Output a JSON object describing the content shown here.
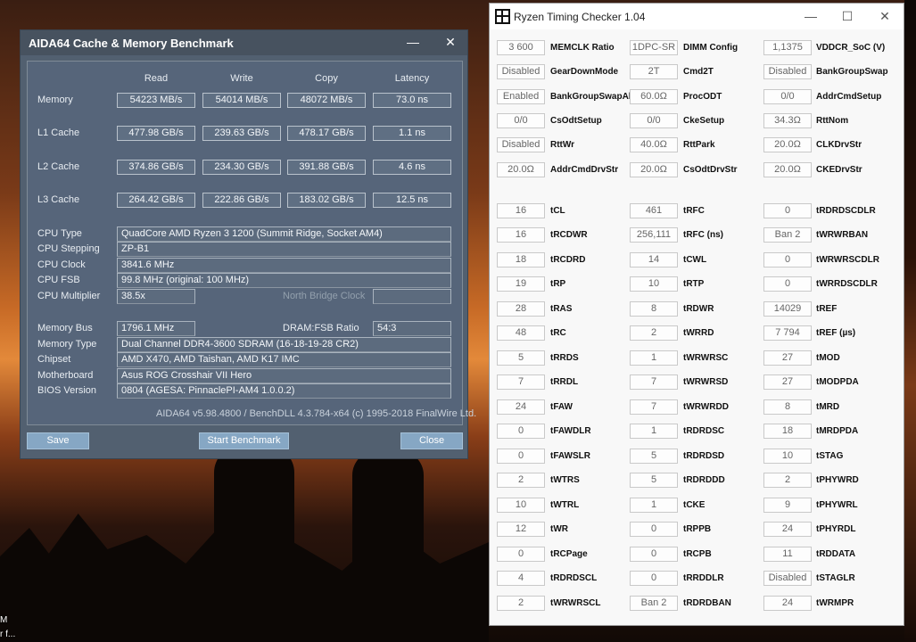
{
  "desktop": {
    "text_lines": [
      "M",
      "r f..."
    ]
  },
  "aida": {
    "title": "AIDA64 Cache & Memory Benchmark",
    "minimize_glyph": "—",
    "close_glyph": "✕",
    "columns": [
      "Read",
      "Write",
      "Copy",
      "Latency"
    ],
    "bench_rows": [
      {
        "label": "Memory",
        "read": "54223 MB/s",
        "write": "54014 MB/s",
        "copy": "48072 MB/s",
        "latency": "73.0 ns"
      },
      {
        "label": "L1 Cache",
        "read": "477.98 GB/s",
        "write": "239.63 GB/s",
        "copy": "478.17 GB/s",
        "latency": "1.1 ns"
      },
      {
        "label": "L2 Cache",
        "read": "374.86 GB/s",
        "write": "234.30 GB/s",
        "copy": "391.88 GB/s",
        "latency": "4.6 ns"
      },
      {
        "label": "L3 Cache",
        "read": "264.42 GB/s",
        "write": "222.86 GB/s",
        "copy": "183.02 GB/s",
        "latency": "12.5 ns"
      }
    ],
    "cpu_type_label": "CPU Type",
    "cpu_type": "QuadCore AMD Ryzen 3 1200  (Summit Ridge, Socket AM4)",
    "cpu_stepping_label": "CPU Stepping",
    "cpu_stepping": "ZP-B1",
    "cpu_clock_label": "CPU Clock",
    "cpu_clock": "3841.6 MHz",
    "cpu_fsb_label": "CPU FSB",
    "cpu_fsb": "99.8 MHz  (original: 100 MHz)",
    "cpu_mult_label": "CPU Multiplier",
    "cpu_mult": "38.5x",
    "nb_clock_label": "North Bridge Clock",
    "nb_clock": "",
    "mem_bus_label": "Memory Bus",
    "mem_bus": "1796.1 MHz",
    "dram_ratio_label": "DRAM:FSB Ratio",
    "dram_ratio": "54:3",
    "mem_type_label": "Memory Type",
    "mem_type": "Dual Channel DDR4-3600 SDRAM  (16-18-19-28 CR2)",
    "chipset_label": "Chipset",
    "chipset": "AMD X470, AMD Taishan, AMD K17 IMC",
    "mobo_label": "Motherboard",
    "mobo": "Asus ROG Crosshair VII Hero",
    "bios_label": "BIOS Version",
    "bios": "0804  (AGESA: PinnaclePI-AM4 1.0.0.2)",
    "footer": "AIDA64 v5.98.4800 / BenchDLL 4.3.784-x64  (c) 1995-2018 FinalWire Ltd.",
    "save_label": "Save",
    "start_label": "Start Benchmark",
    "close_label": "Close"
  },
  "rtc": {
    "title": "Ryzen Timing Checker 1.04",
    "minimize_glyph": "—",
    "maximize_glyph": "☐",
    "close_glyph": "✕",
    "rows": [
      [
        {
          "v": "3 600",
          "l": "MEMCLK Ratio"
        },
        {
          "v": "1DPC-SR",
          "l": "DIMM Config"
        },
        {
          "v": "1,1375",
          "l": "VDDCR_SoC (V)"
        }
      ],
      [
        {
          "v": "Disabled",
          "l": "GearDownMode"
        },
        {
          "v": "2T",
          "l": "Cmd2T"
        },
        {
          "v": "Disabled",
          "l": "BankGroupSwap"
        }
      ],
      [
        {
          "v": "Enabled",
          "l": "BankGroupSwapAlt"
        },
        {
          "v": "60.0Ω",
          "l": "ProcODT"
        },
        {
          "v": "0/0",
          "l": "AddrCmdSetup"
        }
      ],
      [
        {
          "v": "0/0",
          "l": "CsOdtSetup"
        },
        {
          "v": "0/0",
          "l": "CkeSetup"
        },
        {
          "v": "34.3Ω",
          "l": "RttNom"
        }
      ],
      [
        {
          "v": "Disabled",
          "l": "RttWr"
        },
        {
          "v": "40.0Ω",
          "l": "RttPark"
        },
        {
          "v": "20.0Ω",
          "l": "CLKDrvStr"
        }
      ],
      [
        {
          "v": "20.0Ω",
          "l": "AddrCmdDrvStr"
        },
        {
          "v": "20.0Ω",
          "l": "CsOdtDrvStr"
        },
        {
          "v": "20.0Ω",
          "l": "CKEDrvStr"
        }
      ],
      [
        {
          "v": "16",
          "l": "tCL"
        },
        {
          "v": "461",
          "l": "tRFC"
        },
        {
          "v": "0",
          "l": "tRDRDSCDLR"
        }
      ],
      [
        {
          "v": "16",
          "l": "tRCDWR"
        },
        {
          "v": "256,111",
          "l": "tRFC (ns)"
        },
        {
          "v": "Ban 2",
          "l": "tWRWRBAN"
        }
      ],
      [
        {
          "v": "18",
          "l": "tRCDRD"
        },
        {
          "v": "14",
          "l": "tCWL"
        },
        {
          "v": "0",
          "l": "tWRWRSCDLR"
        }
      ],
      [
        {
          "v": "19",
          "l": "tRP"
        },
        {
          "v": "10",
          "l": "tRTP"
        },
        {
          "v": "0",
          "l": "tWRRDSCDLR"
        }
      ],
      [
        {
          "v": "28",
          "l": "tRAS"
        },
        {
          "v": "8",
          "l": "tRDWR"
        },
        {
          "v": "14029",
          "l": "tREF"
        }
      ],
      [
        {
          "v": "48",
          "l": "tRC"
        },
        {
          "v": "2",
          "l": "tWRRD"
        },
        {
          "v": "7 794",
          "l": "tREF (µs)"
        }
      ],
      [
        {
          "v": "5",
          "l": "tRRDS"
        },
        {
          "v": "1",
          "l": "tWRWRSC"
        },
        {
          "v": "27",
          "l": "tMOD"
        }
      ],
      [
        {
          "v": "7",
          "l": "tRRDL"
        },
        {
          "v": "7",
          "l": "tWRWRSD"
        },
        {
          "v": "27",
          "l": "tMODPDA"
        }
      ],
      [
        {
          "v": "24",
          "l": "tFAW"
        },
        {
          "v": "7",
          "l": "tWRWRDD"
        },
        {
          "v": "8",
          "l": "tMRD"
        }
      ],
      [
        {
          "v": "0",
          "l": "tFAWDLR"
        },
        {
          "v": "1",
          "l": "tRDRDSC"
        },
        {
          "v": "18",
          "l": "tMRDPDA"
        }
      ],
      [
        {
          "v": "0",
          "l": "tFAWSLR"
        },
        {
          "v": "5",
          "l": "tRDRDSD"
        },
        {
          "v": "10",
          "l": "tSTAG"
        }
      ],
      [
        {
          "v": "2",
          "l": "tWTRS"
        },
        {
          "v": "5",
          "l": "tRDRDDD"
        },
        {
          "v": "2",
          "l": "tPHYWRD"
        }
      ],
      [
        {
          "v": "10",
          "l": "tWTRL"
        },
        {
          "v": "1",
          "l": "tCKE"
        },
        {
          "v": "9",
          "l": "tPHYWRL"
        }
      ],
      [
        {
          "v": "12",
          "l": "tWR"
        },
        {
          "v": "0",
          "l": "tRPPB"
        },
        {
          "v": "24",
          "l": "tPHYRDL"
        }
      ],
      [
        {
          "v": "0",
          "l": "tRCPage"
        },
        {
          "v": "0",
          "l": "tRCPB"
        },
        {
          "v": "11",
          "l": "tRDDATA"
        }
      ],
      [
        {
          "v": "4",
          "l": "tRDRDSCL"
        },
        {
          "v": "0",
          "l": "tRRDDLR"
        },
        {
          "v": "Disabled",
          "l": "tSTAGLR"
        }
      ],
      [
        {
          "v": "2",
          "l": "tWRWRSCL"
        },
        {
          "v": "Ban 2",
          "l": "tRDRDBAN"
        },
        {
          "v": "24",
          "l": "tWRMPR"
        }
      ]
    ]
  }
}
